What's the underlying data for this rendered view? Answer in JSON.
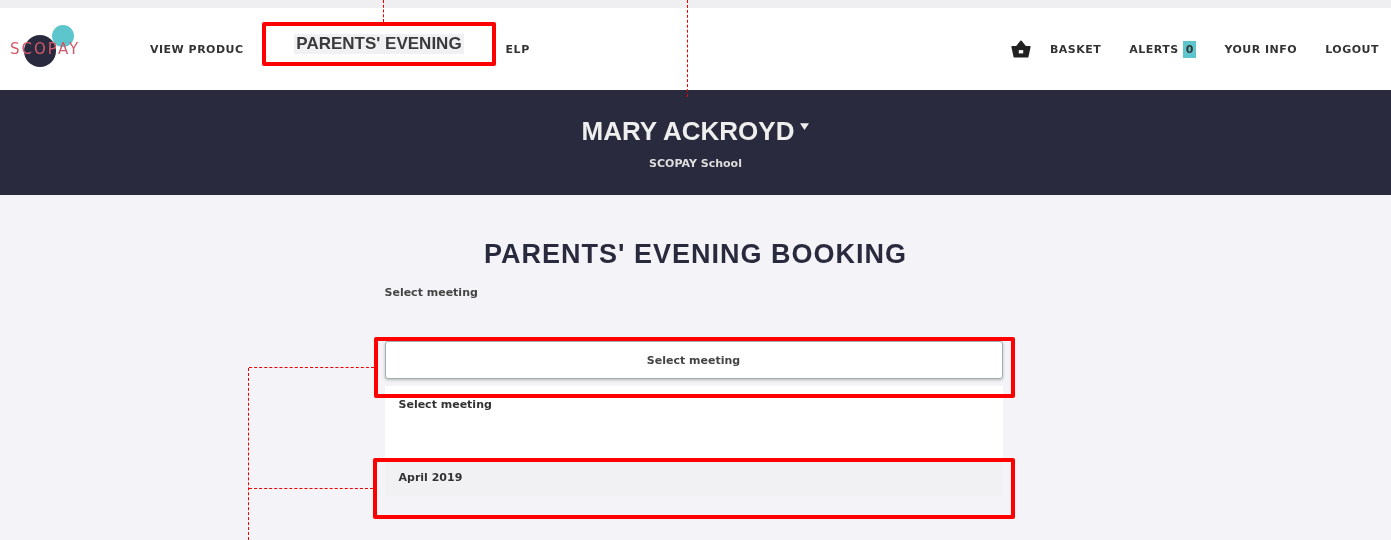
{
  "nav": {
    "logo": "SCOPAY",
    "items_left": [
      {
        "label": "VIEW PRODUC"
      },
      {
        "label": "ELP"
      }
    ],
    "items_right": [
      {
        "label": "BASKET",
        "kind": "basket"
      },
      {
        "label": "ALERTS",
        "kind": "alerts",
        "badge": "0"
      },
      {
        "label": "YOUR INFO",
        "kind": "link"
      },
      {
        "label": "LOGOUT",
        "kind": "link"
      }
    ]
  },
  "header": {
    "name": "MARY ACKROYD",
    "school": "SCOPAY School"
  },
  "title": "PARENTS' EVENING BOOKING",
  "field_label": "Select meeting",
  "select": {
    "value": "Select meeting",
    "expanded": true
  },
  "options": [
    {
      "label": "Select meeting",
      "selected": false
    },
    {
      "label": "April 2019",
      "selected": true
    }
  ],
  "annotation": {
    "label": "PARENTS' EVENING"
  }
}
